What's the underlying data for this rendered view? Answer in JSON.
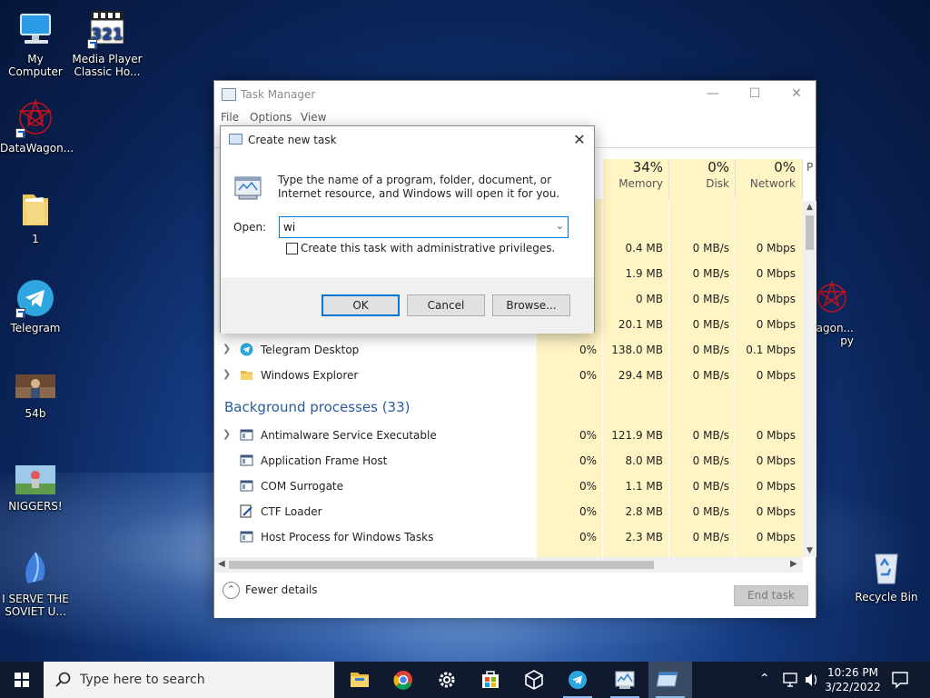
{
  "desktop": {
    "icons": [
      {
        "label": "My Computer",
        "icon": "computer-icon"
      },
      {
        "label": "Media Player Classic Ho...",
        "icon": "media-player-icon"
      },
      {
        "label": "DataWagon...",
        "icon": "datawagon-icon"
      },
      {
        "label": "1",
        "icon": "folder-icon"
      },
      {
        "label": "Telegram",
        "icon": "telegram-icon"
      },
      {
        "label": "54b",
        "icon": "image-file-icon"
      },
      {
        "label": "NIGGERS!",
        "icon": "image-file-icon"
      },
      {
        "label": "I SERVE THE SOVIET U...",
        "icon": "crystal-icon"
      },
      {
        "label": "Recycle Bin",
        "icon": "recycle-bin-icon"
      }
    ],
    "partial_icon_label": "agon...\npy"
  },
  "task_manager": {
    "title": "Task Manager",
    "menu": [
      "File",
      "Options",
      "View"
    ],
    "columns": [
      {
        "pct": "34%",
        "name": "Memory"
      },
      {
        "pct": "0%",
        "name": "Disk"
      },
      {
        "pct": "0%",
        "name": "Network"
      },
      {
        "pct": "",
        "name": "P"
      }
    ],
    "app_rows": [
      {
        "name": "",
        "cpu": "",
        "memory": "0.4 MB",
        "disk": "0 MB/s",
        "network": "0 Mbps"
      },
      {
        "name": "",
        "cpu": "",
        "memory": "1.9 MB",
        "disk": "0 MB/s",
        "network": "0 Mbps"
      },
      {
        "name": "",
        "cpu": "",
        "memory": "0 MB",
        "disk": "0 MB/s",
        "network": "0 Mbps"
      },
      {
        "name": "",
        "cpu": "",
        "memory": "20.1 MB",
        "disk": "0 MB/s",
        "network": "0 Mbps"
      },
      {
        "name": "Telegram Desktop",
        "cpu": "0%",
        "memory": "138.0 MB",
        "disk": "0 MB/s",
        "network": "0.1 Mbps"
      },
      {
        "name": "Windows Explorer",
        "cpu": "0%",
        "memory": "29.4 MB",
        "disk": "0 MB/s",
        "network": "0 Mbps"
      }
    ],
    "background_header": "Background processes (33)",
    "background_rows": [
      {
        "name": "Antimalware Service Executable",
        "cpu": "0%",
        "memory": "121.9 MB",
        "disk": "0 MB/s",
        "network": "0 Mbps"
      },
      {
        "name": "Application Frame Host",
        "cpu": "0%",
        "memory": "8.0 MB",
        "disk": "0 MB/s",
        "network": "0 Mbps"
      },
      {
        "name": "COM Surrogate",
        "cpu": "0%",
        "memory": "1.1 MB",
        "disk": "0 MB/s",
        "network": "0 Mbps"
      },
      {
        "name": "CTF Loader",
        "cpu": "0%",
        "memory": "2.8 MB",
        "disk": "0 MB/s",
        "network": "0 Mbps"
      },
      {
        "name": "Host Process for Windows Tasks",
        "cpu": "0%",
        "memory": "2.3 MB",
        "disk": "0 MB/s",
        "network": "0 Mbps"
      }
    ],
    "fewer_details": "Fewer details",
    "end_task": "End task"
  },
  "run_dialog": {
    "title": "Create new task",
    "description": "Type the name of a program, folder, document, or Internet resource, and Windows will open it for you.",
    "open_label": "Open:",
    "open_value": "wi",
    "admin_checkbox_label": "Create this task with administrative privileges.",
    "admin_checked": false,
    "ok": "OK",
    "cancel": "Cancel",
    "browse": "Browse..."
  },
  "taskbar": {
    "search_placeholder": "Type here to search",
    "pinned": [
      "file-explorer-icon",
      "chrome-icon",
      "settings-icon",
      "store-icon",
      "3d-box-icon",
      "telegram-icon",
      "task-manager-icon",
      "run-dialog-icon"
    ],
    "time": "10:26 PM",
    "date": "3/22/2022"
  },
  "colors": {
    "accent": "#0078d7",
    "heat": "#fff4c4",
    "section_text": "#2a5a9e",
    "taskbar": "#101a2e"
  }
}
